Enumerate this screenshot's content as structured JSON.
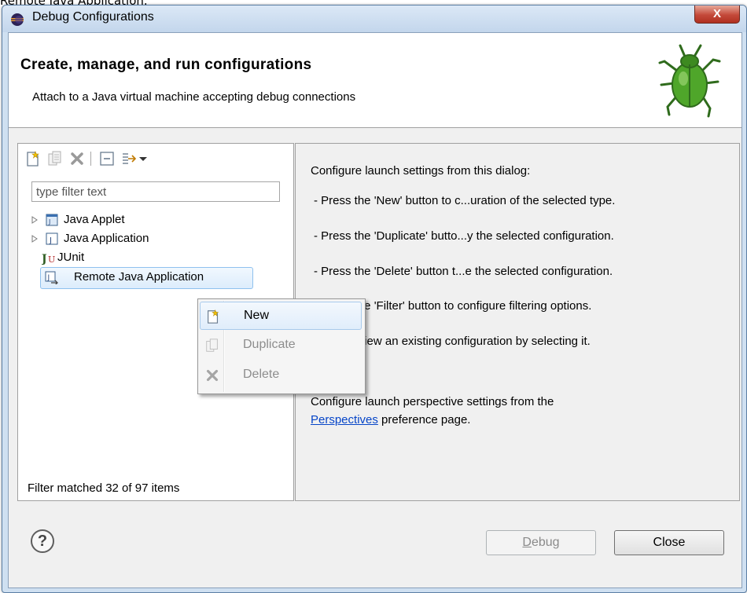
{
  "caption": "Remote Java Application.",
  "window": {
    "title": "Debug Configurations",
    "close_label": "X"
  },
  "header": {
    "title": "Create, manage, and run configurations",
    "subtitle": "Attach to a Java virtual machine accepting debug connections"
  },
  "filter": {
    "placeholder": "type filter text",
    "value": ""
  },
  "tree": {
    "items": [
      {
        "label": "Java Applet",
        "icon": "java-applet-icon",
        "expandable": true
      },
      {
        "label": "Java Application",
        "icon": "java-application-icon",
        "expandable": true
      },
      {
        "label": "JUnit",
        "icon": "junit-icon",
        "expandable": false
      },
      {
        "label": "Remote Java Application",
        "icon": "remote-java-icon",
        "expandable": false,
        "selected": true
      }
    ],
    "status": "Filter matched 32 of 97 items"
  },
  "context_menu": {
    "items": [
      {
        "label": "New",
        "enabled": true,
        "highlighted": true
      },
      {
        "label": "Duplicate",
        "enabled": false
      },
      {
        "label": "Delete",
        "enabled": false
      }
    ]
  },
  "right_panel": {
    "intro": "Configure launch settings from this dialog:",
    "lines": [
      "- Press the 'New' button to c...uration of the selected type.",
      "- Press the 'Duplicate' butto...y the selected configuration.",
      "- Press the 'Delete' button t...e the selected configuration.",
      "- Press the 'Filter' button to configure filtering options.",
      "- Edit or view an existing configuration by selecting it."
    ],
    "perspective_line": "Configure launch perspective settings from the",
    "link": "Perspectives",
    "link_suffix": " preference page."
  },
  "buttons": {
    "debug_mnemonic": "D",
    "debug_rest": "ebug",
    "close": "Close",
    "help": "?"
  }
}
